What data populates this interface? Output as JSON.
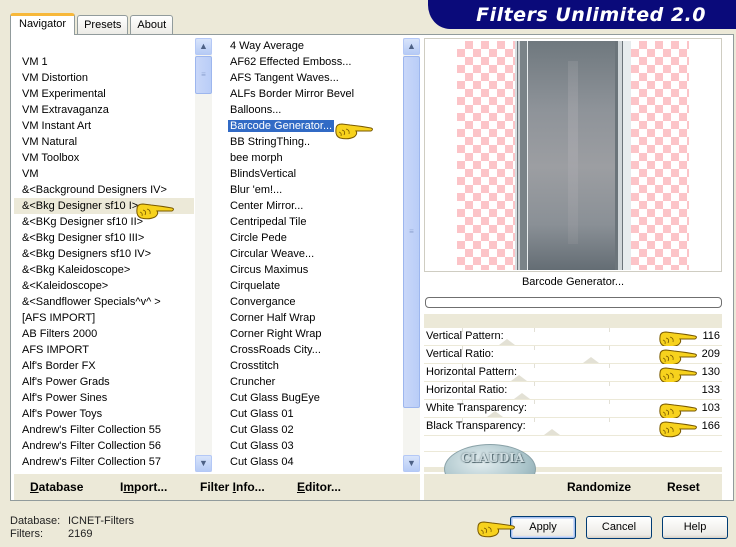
{
  "banner": {
    "title": "Filters Unlimited 2.0"
  },
  "tabs": [
    {
      "label": "Navigator",
      "active": true
    },
    {
      "label": "Presets",
      "active": false
    },
    {
      "label": "About",
      "active": false
    }
  ],
  "categories": {
    "items": [
      "VM 1",
      "VM Distortion",
      "VM Experimental",
      "VM Extravaganza",
      "VM Instant Art",
      "VM Natural",
      "VM Toolbox",
      "VM",
      "&<Background Designers IV>",
      "&<Bkg Designer sf10 I>",
      "&<BKg Designer sf10 II>",
      "&<Bkg Designer sf10 III>",
      "&<Bkg Designers sf10 IV>",
      "&<Bkg Kaleidoscope>",
      "&<Kaleidoscope>",
      "&<Sandflower Specials^v^ >",
      "[AFS IMPORT]",
      "AB Filters 2000",
      "AFS IMPORT",
      "Alf's Border FX",
      "Alf's Power Grads",
      "Alf's Power Sines",
      "Alf's Power Toys",
      "Andrew's Filter Collection 55",
      "Andrew's Filter Collection 56",
      "Andrew's Filter Collection 57"
    ],
    "selected_index": 9
  },
  "filters": {
    "items": [
      "4 Way Average",
      "AF62 Effected Emboss...",
      "AFS Tangent Waves...",
      "ALFs Border Mirror Bevel",
      "Balloons...",
      "Barcode Generator...",
      "BB StringThing..",
      "bee morph",
      "BlindsVertical",
      "Blur 'em!...",
      "Center Mirror...",
      "Centripedal Tile",
      "Circle Pede",
      "Circular Weave...",
      "Circus Maximus",
      "Cirquelate",
      "Convergance",
      "Corner Half Wrap",
      "Corner Right Wrap",
      "CrossRoads City...",
      "Crosstitch",
      "Cruncher",
      "Cut Glass  BugEye",
      "Cut Glass 01",
      "Cut Glass 02",
      "Cut Glass 03",
      "Cut Glass 04"
    ],
    "selected_index": 5
  },
  "preview": {
    "filter_name": "Barcode Generator..."
  },
  "params": [
    {
      "label": "Vertical Pattern:",
      "value": "116",
      "pointer": true
    },
    {
      "label": "Vertical Ratio:",
      "value": "209",
      "pointer": true
    },
    {
      "label": "Horizontal Pattern:",
      "value": "130",
      "pointer": true
    },
    {
      "label": "Horizontal Ratio:",
      "value": "133",
      "pointer": false
    },
    {
      "label": "White Transparency:",
      "value": "103",
      "pointer": true
    },
    {
      "label": "Black Transparency:",
      "value": "166",
      "pointer": true
    }
  ],
  "toolbar": {
    "database": "Database",
    "import": "Import...",
    "filter_info": "Filter Info...",
    "editor": "Editor...",
    "randomize": "Randomize",
    "reset": "Reset"
  },
  "status": {
    "database_label": "Database:",
    "database_value": "ICNET-Filters",
    "filters_label": "Filters:",
    "filters_value": "2169"
  },
  "buttons": {
    "apply": "Apply",
    "cancel": "Cancel",
    "help": "Help"
  },
  "watermark": {
    "text": "CLAUDIA"
  },
  "colors": {
    "banner": "#0a0a7a",
    "selection": "#316ac5",
    "dialog_bg": "#ece9d8"
  }
}
